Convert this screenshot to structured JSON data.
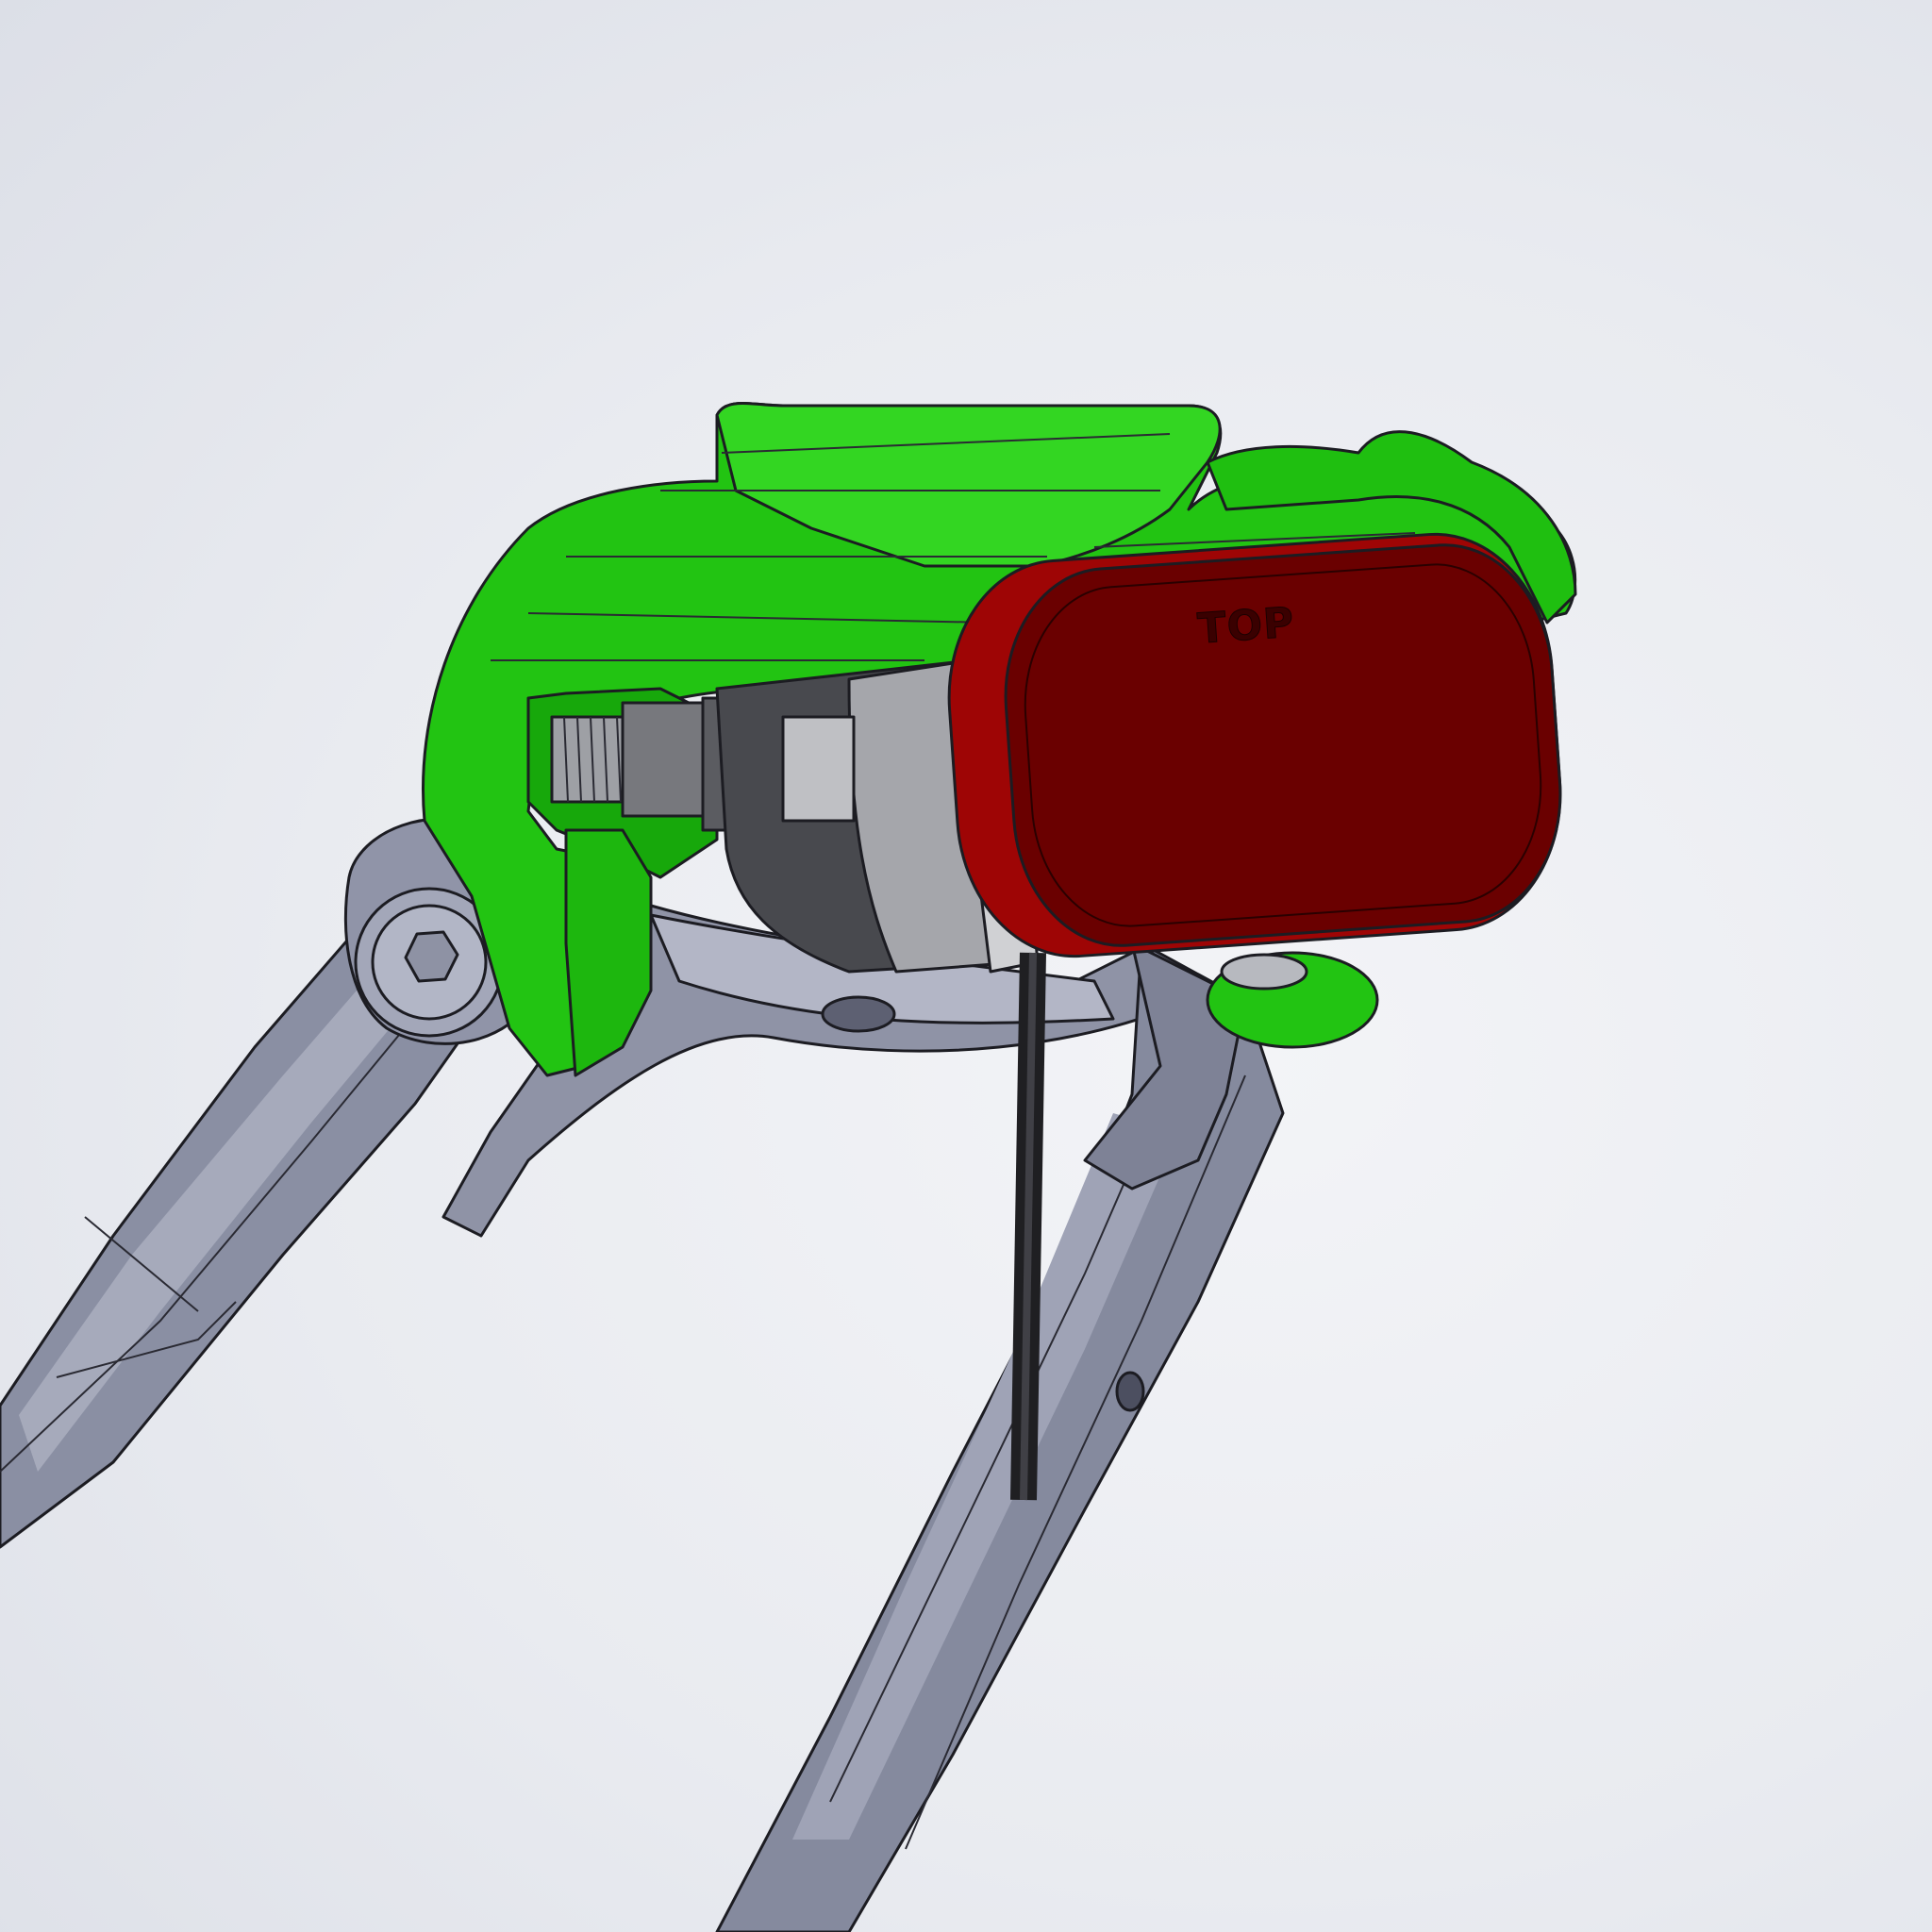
{
  "model": {
    "label_top": "TOP",
    "colors": {
      "background": "#e9ebf0",
      "bracket_green": "#1fbf10",
      "bracket_green_dark": "#139a0a",
      "reflector_red": "#6a0000",
      "reflector_rim": "#9e0505",
      "frame_gray": "#8a8fa3",
      "frame_gray_dark": "#6d7186",
      "hardware_gray": "#bfc0c4",
      "hardware_dark": "#4a4b50",
      "cable_black": "#2b2b2e"
    }
  }
}
